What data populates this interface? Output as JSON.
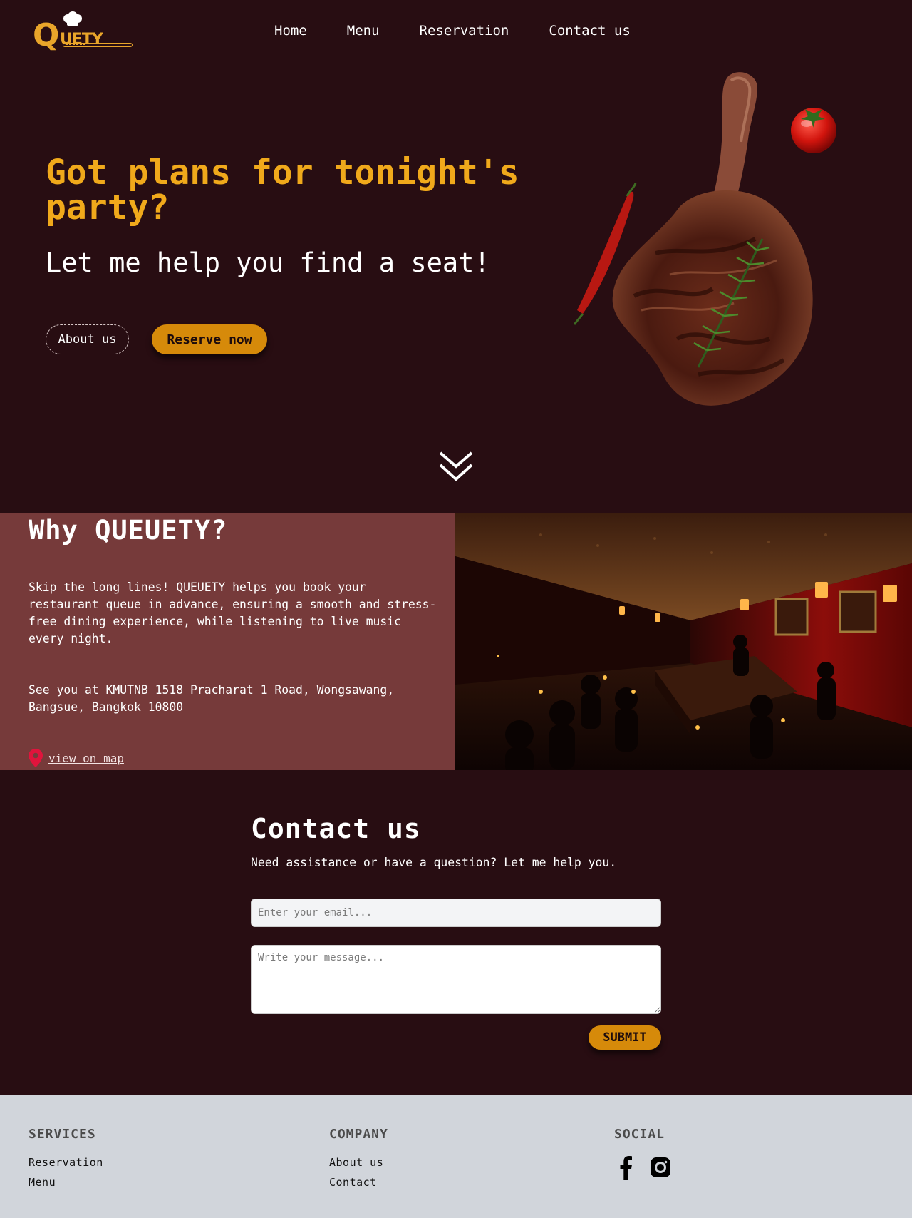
{
  "brand": {
    "logo_text": "QUETY",
    "accent_color": "#f0a91b",
    "button_color": "#d68a0a"
  },
  "nav": {
    "items": [
      {
        "label": "Home"
      },
      {
        "label": "Menu"
      },
      {
        "label": "Reservation"
      },
      {
        "label": "Contact us"
      }
    ]
  },
  "hero": {
    "title": "Got plans for tonight's party?",
    "subtitle": "Let me help you find a seat!",
    "about_button": "About us",
    "reserve_button": "Reserve now",
    "image_icon": "steak-tomahawk-illustration",
    "scroll_icon": "double-chevron-down-icon"
  },
  "why": {
    "title": "Why QUEUETY?",
    "body": "Skip the long lines! QUEUETY helps you book your restaurant queue in advance, ensuring a smooth and stress-free dining experience, while listening to live music every night.",
    "address": "See you at KMUTNB 1518 Pracharat 1 Road, Wongsawang, Bangsue, Bangkok 10800",
    "map_link": "view on map",
    "image_icon": "restaurant-live-music-photo"
  },
  "contact": {
    "title": "Contact us",
    "subtitle": "Need assistance or have a question? Let me help you.",
    "email_placeholder": "Enter your email...",
    "message_placeholder": "Write your message...",
    "submit_label": "SUBMIT"
  },
  "footer": {
    "services": {
      "heading": "SERVICES",
      "links": [
        "Reservation",
        "Menu"
      ]
    },
    "company": {
      "heading": "COMPANY",
      "links": [
        "About us",
        "Contact"
      ]
    },
    "social": {
      "heading": "SOCIAL",
      "icons": [
        "facebook-icon",
        "instagram-icon"
      ]
    }
  }
}
